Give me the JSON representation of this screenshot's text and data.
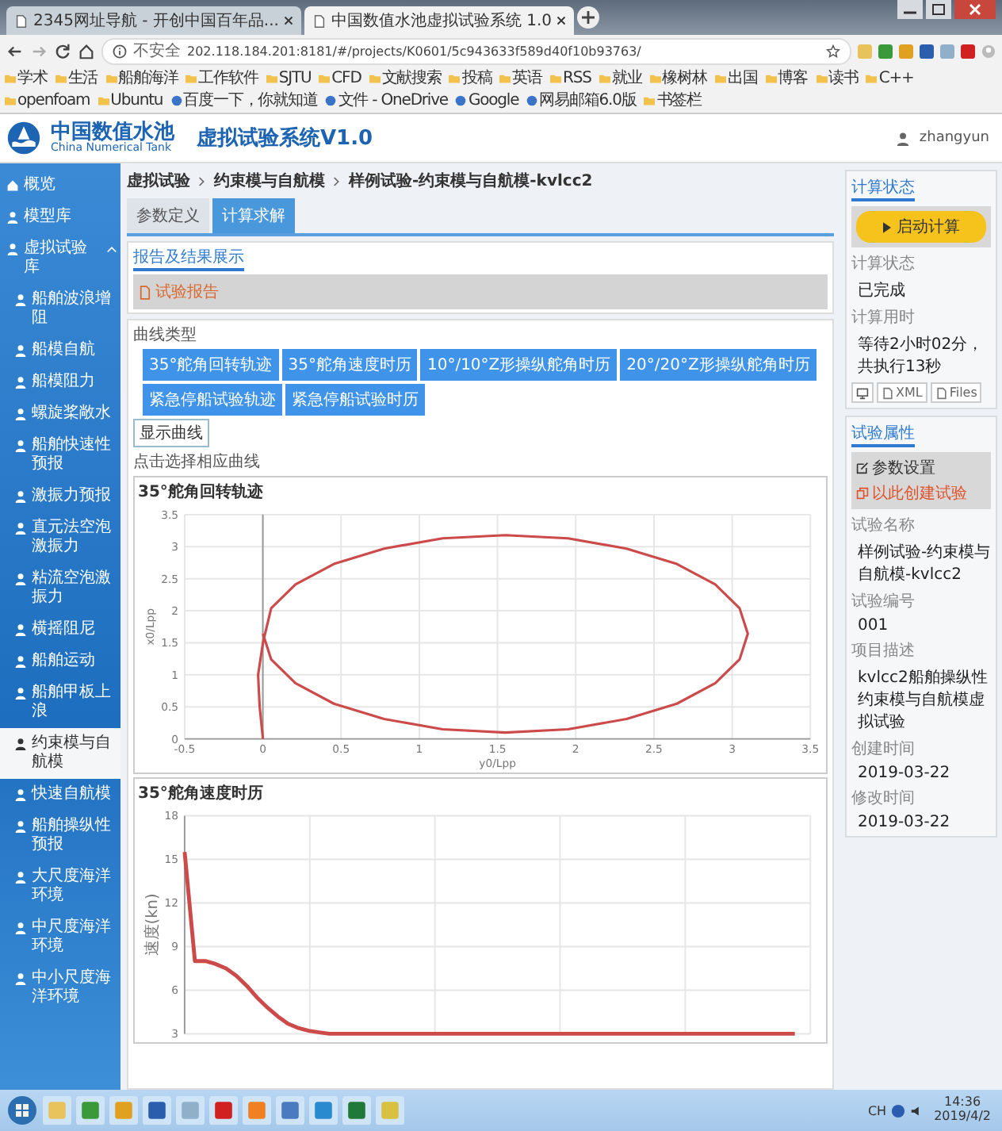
{
  "browser": {
    "tabs": [
      {
        "title": "2345网址导航 - 开创中国百年品...",
        "selected": false
      },
      {
        "title": "中国数值水池虚拟试验系统 1.0",
        "selected": true
      }
    ],
    "address": {
      "security": "不安全",
      "url": "202.118.184.201:8181/#/projects/K0601/5c943633f589d40f10b93763/"
    },
    "bookmarks": [
      {
        "label": "学术",
        "kind": "folder"
      },
      {
        "label": "生活",
        "kind": "folder"
      },
      {
        "label": "船舶海洋",
        "kind": "folder"
      },
      {
        "label": "工作软件",
        "kind": "folder"
      },
      {
        "label": "SJTU",
        "kind": "folder"
      },
      {
        "label": "CFD",
        "kind": "folder"
      },
      {
        "label": "文献搜索",
        "kind": "folder"
      },
      {
        "label": "投稿",
        "kind": "folder"
      },
      {
        "label": "英语",
        "kind": "folder"
      },
      {
        "label": "RSS",
        "kind": "folder"
      },
      {
        "label": "就业",
        "kind": "folder"
      },
      {
        "label": "橡树林",
        "kind": "folder"
      },
      {
        "label": "出国",
        "kind": "folder"
      },
      {
        "label": "博客",
        "kind": "folder"
      },
      {
        "label": "读书",
        "kind": "folder"
      },
      {
        "label": "C++",
        "kind": "folder"
      },
      {
        "label": "openfoam",
        "kind": "folder"
      },
      {
        "label": "Ubuntu",
        "kind": "folder"
      },
      {
        "label": "百度一下，你就知道",
        "kind": "link"
      },
      {
        "label": "文件 - OneDrive",
        "kind": "link"
      },
      {
        "label": "Google",
        "kind": "link"
      },
      {
        "label": "网易邮箱6.0版",
        "kind": "link"
      },
      {
        "label": "书签栏",
        "kind": "folder"
      }
    ]
  },
  "app": {
    "logo": {
      "name": "中国数值水池",
      "subtitle": "China Numerical Tank"
    },
    "title": "虚拟试验系统V1.0",
    "user": "zhangyun"
  },
  "sidebar": {
    "items": [
      {
        "label": "概览",
        "selected": false
      },
      {
        "label": "模型库",
        "selected": false
      },
      {
        "label": "虚拟试验库",
        "selected": false,
        "expanded": true,
        "children": [
          {
            "label": "船舶波浪增阻",
            "selected": false
          },
          {
            "label": "船模自航",
            "selected": false
          },
          {
            "label": "船模阻力",
            "selected": false
          },
          {
            "label": "螺旋桨敞水",
            "selected": false
          },
          {
            "label": "船舶快速性预报",
            "selected": false
          },
          {
            "label": "激振力预报",
            "selected": false
          },
          {
            "label": "直元法空泡激振力",
            "selected": false
          },
          {
            "label": "粘流空泡激振力",
            "selected": false
          },
          {
            "label": "横摇阻尼",
            "selected": false
          },
          {
            "label": "船舶运动",
            "selected": false
          },
          {
            "label": "船舶甲板上浪",
            "selected": false
          },
          {
            "label": "约束模与自航模",
            "selected": true
          },
          {
            "label": "快速自航模",
            "selected": false
          },
          {
            "label": "船舶操纵性预报",
            "selected": false
          },
          {
            "label": "大尺度海洋环境",
            "selected": false
          },
          {
            "label": "中尺度海洋环境",
            "selected": false
          },
          {
            "label": "中小尺度海洋环境",
            "selected": false
          }
        ]
      }
    ]
  },
  "main": {
    "breadcrumb": [
      "虚拟试验",
      "约束模与自航模",
      "样例试验-约束模与自航模-kvlcc2"
    ],
    "tabs": [
      {
        "label": "参数定义",
        "selected": false
      },
      {
        "label": "计算求解",
        "selected": true
      }
    ],
    "report": {
      "heading": "报告及结果展示",
      "link": "试验报告"
    },
    "curves": {
      "label": "曲线类型",
      "buttons": [
        "35°舵角回转轨迹",
        "35°舵角速度时历",
        "10°/10°Z形操纵舵角时历",
        "20°/20°Z形操纵舵角时历",
        "紧急停船试验轨迹",
        "紧急停船试验时历"
      ],
      "show_button": "显示曲线",
      "hint": "点击选择相应曲线"
    },
    "charts": [
      {
        "chart_data": {
          "type": "line",
          "title": "35°舵角回转轨迹",
          "xlabel": "y0/Lpp",
          "ylabel": "x0/Lpp",
          "xlim": [
            -0.5,
            3.5
          ],
          "ylim": [
            0,
            3.5
          ],
          "grid": true,
          "xticks": [
            -0.5,
            0,
            0.5,
            1,
            1.5,
            2,
            2.5,
            3,
            3.5
          ],
          "yticks": [
            0,
            0.5,
            1,
            1.5,
            2,
            2.5,
            3,
            3.5
          ],
          "x": [
            0,
            -0.02,
            -0.03,
            0,
            0.053,
            0.208,
            0.454,
            0.775,
            1.149,
            1.55,
            1.951,
            2.325,
            2.646,
            2.892,
            3.047,
            3.1,
            3.047,
            2.892,
            2.646,
            2.325,
            1.951,
            1.55,
            1.149,
            0.775,
            0.454,
            0.208,
            0.053,
            0
          ],
          "series": [
            {
              "color": "#cc4a4a",
              "values": [
                0,
                0.5,
                1,
                1.5,
                2.04,
                2.41,
                2.73,
                2.97,
                3.13,
                3.18,
                3.13,
                2.97,
                2.73,
                2.41,
                2.04,
                1.64,
                1.24,
                0.87,
                0.55,
                0.31,
                0.15,
                0.1,
                0.15,
                0.31,
                0.55,
                0.87,
                1.24,
                1.64
              ]
            }
          ]
        }
      },
      {
        "chart_data": {
          "type": "line",
          "title": "35°舵角速度时历",
          "ylabel": "速度(kn)",
          "ylim": [
            3,
            18
          ],
          "yticks": [
            3,
            6,
            9,
            12,
            15,
            18
          ],
          "grid": true,
          "series": [
            {
              "color": "#cc4a4a",
              "values": [
                15.5,
                8,
                8,
                7.8,
                7.5,
                7,
                6.3,
                5.5,
                4.8,
                4.2,
                3.7,
                3.4,
                3.2,
                3.1,
                3,
                3,
                3,
                3,
                3,
                3,
                3,
                3,
                3,
                3,
                3,
                3,
                3,
                3,
                3,
                3,
                3,
                3,
                3,
                3,
                3,
                3,
                3,
                3,
                3,
                3,
                3,
                3,
                3,
                3,
                3,
                3,
                3,
                3,
                3,
                3,
                3,
                3,
                3,
                3,
                3,
                3,
                3,
                3,
                3,
                3
              ]
            }
          ]
        }
      }
    ]
  },
  "panel": {
    "status": {
      "heading": "计算状态",
      "start_button": "启动计算",
      "fields": [
        {
          "label": "计算状态",
          "value": "已完成"
        },
        {
          "label": "计算用时",
          "value": "等待2小时02分，共执行13秒"
        }
      ],
      "tools": [
        "XML",
        "Files"
      ]
    },
    "attributes": {
      "heading": "试验属性",
      "actions": [
        {
          "label": "参数设置",
          "kind": "edit"
        },
        {
          "label": "以此创建试验",
          "kind": "copy"
        }
      ],
      "fields": [
        {
          "label": "试验名称",
          "value": "样例试验-约束模与自航模-kvlcc2"
        },
        {
          "label": "试验编号",
          "value": "001"
        },
        {
          "label": "项目描述",
          "value": "kvlcc2船舶操纵性约束模与自航模虚拟试验"
        },
        {
          "label": "创建时间",
          "value": "2019-03-22"
        },
        {
          "label": "修改时间",
          "value": "2019-03-22"
        }
      ]
    }
  },
  "taskbar": {
    "language": "CH",
    "time": "14:36",
    "date": "2019/4/2"
  }
}
